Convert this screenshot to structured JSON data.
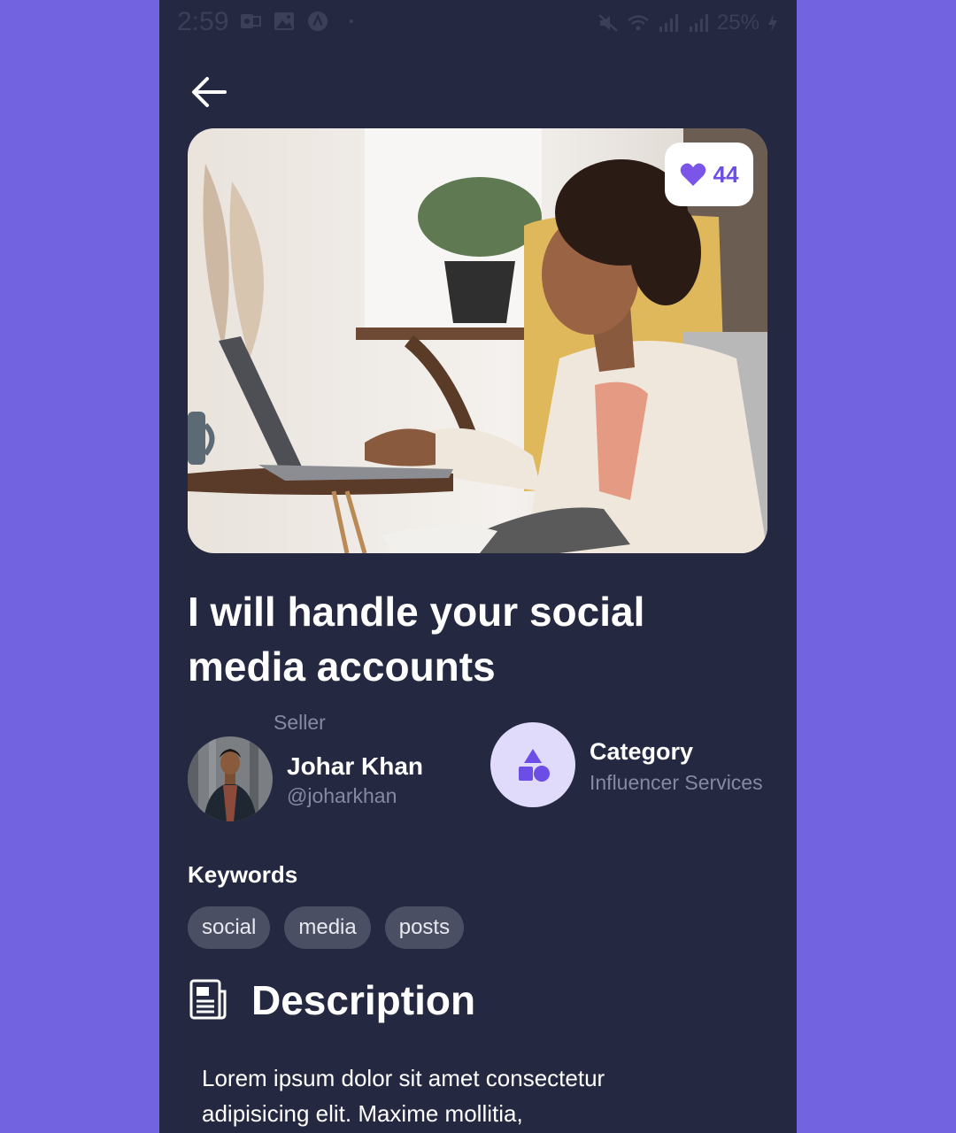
{
  "status_bar": {
    "time": "2:59",
    "battery": "25%",
    "left_icons": [
      "outlook-icon",
      "image-icon",
      "app-a-icon",
      "dot-icon"
    ],
    "right_icons": [
      "mute-icon",
      "wifi-icon",
      "signal-icon",
      "signal-icon",
      "charging-icon"
    ]
  },
  "hero": {
    "likes": "44",
    "image_icon": "photo-woman-laptop"
  },
  "gig": {
    "title": "I will handle your social media accounts"
  },
  "seller": {
    "label": "Seller",
    "name": "Johar Khan",
    "handle": "@joharkhan"
  },
  "category": {
    "label": "Category",
    "value": "Influencer Services",
    "icon": "shapes-icon"
  },
  "keywords": {
    "label": "Keywords",
    "items": [
      "social",
      "media",
      "posts"
    ]
  },
  "description": {
    "heading": "Description",
    "text": "Lorem ipsum dolor sit amet consectetur adipisicing elit. Maxime mollitia,"
  },
  "colors": {
    "background": "#7263e0",
    "panel": "#252841",
    "accent": "#6c4ee6",
    "chip": "#4b4f64",
    "muted": "#858aa3",
    "category_bg": "#e1dbfb"
  }
}
